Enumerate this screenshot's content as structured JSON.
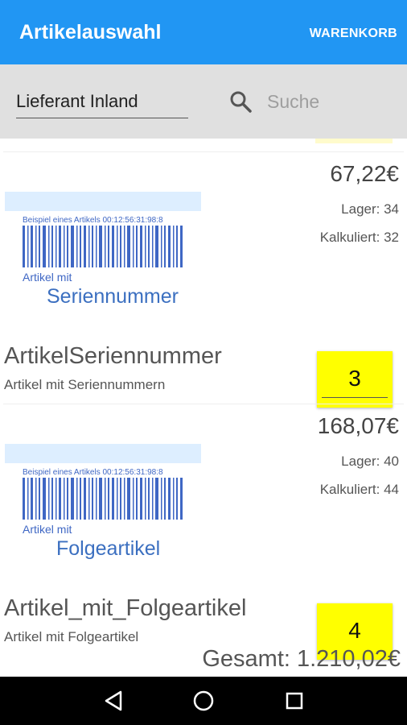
{
  "appbar": {
    "title": "Artikelauswahl",
    "cart_label": "WARENKORB"
  },
  "filter": {
    "supplier": "Lieferant Inland",
    "search_placeholder": "Suche"
  },
  "items": [
    {
      "price": "67,22€",
      "stock": "Lager: 34",
      "calculated": "Kalkuliert: 32",
      "image_barcode_text": "Beispiel eines Artikels 00:12:56:31:98:8",
      "image_caption_small": "Artikel mit",
      "image_caption_large": "Seriennummer",
      "name": "ArtikelSeriennummer",
      "description": "Artikel mit Seriennummern",
      "quantity": "3"
    },
    {
      "price": "168,07€",
      "stock": "Lager: 40",
      "calculated": "Kalkuliert: 44",
      "image_barcode_text": "Beispiel eines Artikels 00:12:56:31:98:8",
      "image_caption_small": "Artikel mit",
      "image_caption_large": "Folgeartikel",
      "name": "Artikel_mit_Folgeartikel",
      "description": "Artikel mit Folgeartikel",
      "quantity": "4"
    }
  ],
  "total": "Gesamt: 1.210,02€",
  "colors": {
    "primary": "#2196f3",
    "quantity_bg": "#ffff00",
    "barcode": "#3f67c4"
  },
  "navbar": {
    "icons": [
      "back-icon",
      "home-icon",
      "recents-icon"
    ]
  }
}
